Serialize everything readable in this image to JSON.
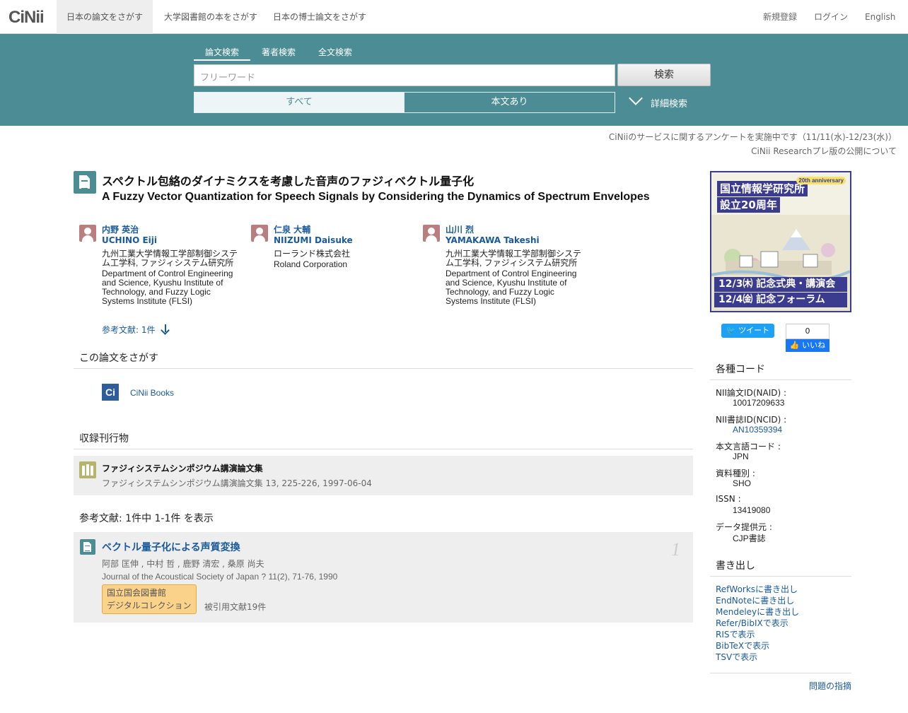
{
  "nav": {
    "logo": "CiNii",
    "tabs": [
      "日本の論文をさがす",
      "大学図書館の本をさがす",
      "日本の博士論文をさがす"
    ],
    "register": "新規登録",
    "login": "ログイン",
    "english": "English"
  },
  "search": {
    "tabs": [
      "論文検索",
      "著者検索",
      "全文検索"
    ],
    "placeholder": "フリーワード",
    "button": "検索",
    "filter_all": "すべて",
    "filter_fulltext": "本文あり",
    "advanced": "詳細検索"
  },
  "notices": [
    "CiNiiのサービスに関するアンケートを実施中です（11/11(水)-12/23(水)）",
    "CiNii Researchプレ版の公開について"
  ],
  "article": {
    "title_ja": "スペクトル包絡のダイナミクスを考慮した音声のファジィベクトル量子化",
    "title_en": "A Fuzzy Vector Quantization for Speech Signals by Considering the Dynamics of Spectrum Envelopes",
    "authors": [
      {
        "name_ja": "内野 英治",
        "name_en": "UCHINO Eiji",
        "aff_ja": "九州工業大学情報工学部制御システム工学科, ファジィシステム研究所",
        "aff_en": "Department of Control Engineering and Science, Kyushu Institute of Technology, and Fuzzy Logic Systems Institute (FLSI)"
      },
      {
        "name_ja": "仁泉 大輔",
        "name_en": "NIIZUMI Daisuke",
        "aff_ja": "ローランド株式会社",
        "aff_en": "Roland Corporation"
      },
      {
        "name_ja": "山川 烈",
        "name_en": "YAMAKAWA Takeshi",
        "aff_ja": "九州工業大学情報工学部制御システム工学科, ファジィシステム研究所",
        "aff_en": "Department of Control Engineering and Science, Kyushu Institute of Technology, and Fuzzy Logic Systems Institute (FLSI)"
      }
    ],
    "refs_link": "参考文献: 1件"
  },
  "find": {
    "heading": "この論文をさがす",
    "cinii_books": "CiNii Books"
  },
  "journal": {
    "heading": "収録刊行物",
    "title": "ファジィシステムシンポジウム講演論文集",
    "sub": "ファジィシステムシンポジウム講演論文集 13, 225-226, 1997-06-04"
  },
  "references": {
    "heading": "参考文献:  1件中 1-1件 を表示",
    "items": [
      {
        "num": "1",
        "title": "ベクトル量子化による声質変換",
        "authors": "阿部 匡伸 , 中村 哲 , 鹿野 清宏 , 桑原 尚夫",
        "journal": "Journal of the Acoustical Society of Japan ? 11(2), 71-76, 1990",
        "badge_line1": "国立国会図書館",
        "badge_line2": "デジタルコレクション",
        "cited": "被引用文献19件"
      }
    ]
  },
  "banner": {
    "line1": "国立情報学研究所",
    "line2": "設立20周年",
    "event1": "12/3㈭ 記念式典・講演会",
    "event2": "12/4㈮ 記念フォーラム",
    "badge": "20th anniversary"
  },
  "social": {
    "tweet": "ツイート",
    "like_count": "0",
    "like": "いいね"
  },
  "codes": {
    "heading": "各種コード",
    "items": [
      {
        "label": "NII論文ID(NAID) :",
        "value": "10017209633",
        "link": false
      },
      {
        "label": "NII書誌ID(NCID) :",
        "value": "AN10359394",
        "link": true
      },
      {
        "label": "本文言語コード :",
        "value": "JPN",
        "link": false
      },
      {
        "label": "資料種別 :",
        "value": "SHO",
        "link": false
      },
      {
        "label": "ISSN :",
        "value": "13419080",
        "link": false
      },
      {
        "label": "データ提供元 :",
        "value": "CJP書誌",
        "link": false
      }
    ]
  },
  "export": {
    "heading": "書き出し",
    "items": [
      "RefWorksに書き出し",
      "EndNoteに書き出し",
      "Mendeleyに書き出し",
      "Refer/BibIXで表示",
      "RISで表示",
      "BibTeXで表示",
      "TSVで表示"
    ]
  },
  "report": "問題の指摘"
}
